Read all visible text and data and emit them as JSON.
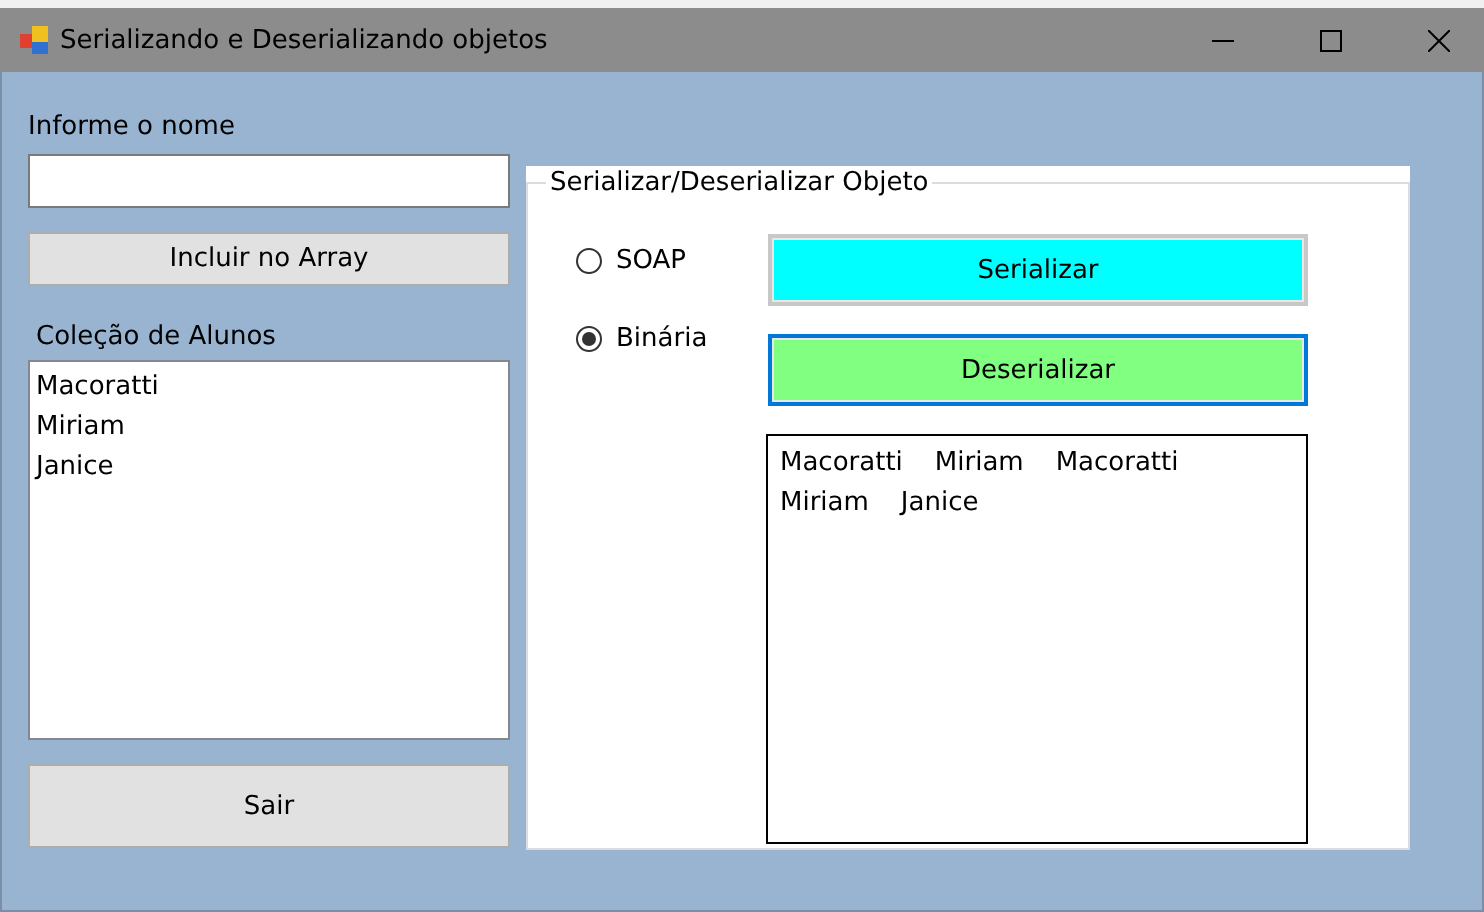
{
  "window": {
    "title": "Serializando e Deserializando objetos"
  },
  "name_label": "Informe o nome",
  "add_button": "Incluir no Array",
  "list_label": "Coleção de Alunos",
  "students": [
    "Macoratti",
    "Miriam",
    "Janice"
  ],
  "exit_button": "Sair",
  "group": {
    "title": "Serializar/Deserializar Objeto",
    "formats": [
      {
        "label": "SOAP",
        "selected": false
      },
      {
        "label": "Binária",
        "selected": true
      }
    ],
    "buttons": [
      {
        "label": "Serializar",
        "color": "#00ffff",
        "focused": false
      },
      {
        "label": "Deserializar",
        "color": "#80ff80",
        "focused": true
      }
    ],
    "output": [
      "Macoratti",
      "Miriam",
      "Macoratti",
      "Miriam",
      "Janice"
    ]
  }
}
